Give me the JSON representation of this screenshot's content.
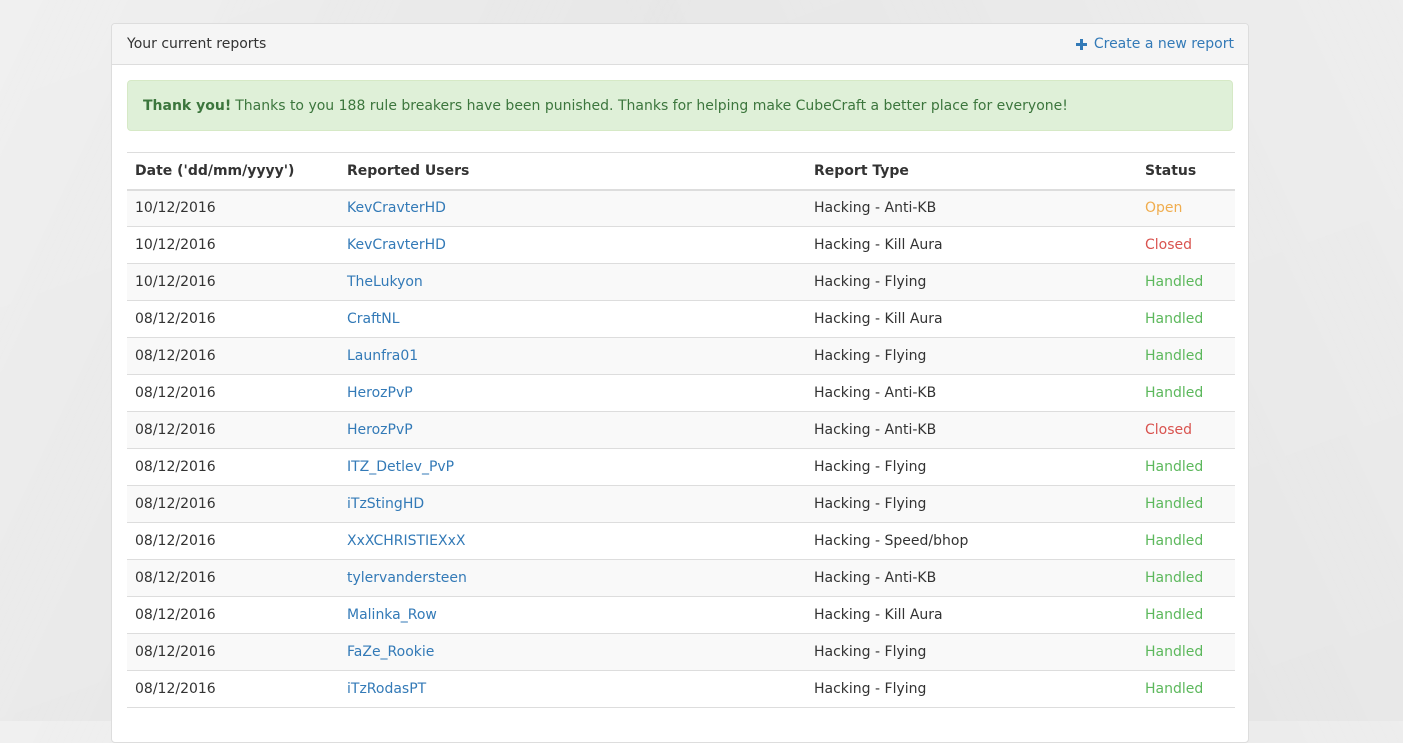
{
  "panel": {
    "title": "Your current reports",
    "create_link": "Create a new report"
  },
  "alert": {
    "strong": "Thank you!",
    "message": "Thanks to you 188 rule breakers have been punished. Thanks for helping make CubeCraft a better place for everyone!"
  },
  "table": {
    "headers": {
      "date": "Date ('dd/mm/yyyy')",
      "users": "Reported Users",
      "type": "Report Type",
      "status": "Status"
    },
    "rows": [
      {
        "date": "10/12/2016",
        "user": "KevCravterHD",
        "type": "Hacking - Anti-KB",
        "status": "Open",
        "status_class": "open"
      },
      {
        "date": "10/12/2016",
        "user": "KevCravterHD",
        "type": "Hacking - Kill Aura",
        "status": "Closed",
        "status_class": "closed"
      },
      {
        "date": "10/12/2016",
        "user": "TheLukyon",
        "type": "Hacking - Flying",
        "status": "Handled",
        "status_class": "handled"
      },
      {
        "date": "08/12/2016",
        "user": "CraftNL",
        "type": "Hacking - Kill Aura",
        "status": "Handled",
        "status_class": "handled"
      },
      {
        "date": "08/12/2016",
        "user": "Launfra01",
        "type": "Hacking - Flying",
        "status": "Handled",
        "status_class": "handled"
      },
      {
        "date": "08/12/2016",
        "user": "HerozPvP",
        "type": "Hacking - Anti-KB",
        "status": "Handled",
        "status_class": "handled"
      },
      {
        "date": "08/12/2016",
        "user": "HerozPvP",
        "type": "Hacking - Anti-KB",
        "status": "Closed",
        "status_class": "closed"
      },
      {
        "date": "08/12/2016",
        "user": "ITZ_Detlev_PvP",
        "type": "Hacking - Flying",
        "status": "Handled",
        "status_class": "handled"
      },
      {
        "date": "08/12/2016",
        "user": "iTzStingHD",
        "type": "Hacking - Flying",
        "status": "Handled",
        "status_class": "handled"
      },
      {
        "date": "08/12/2016",
        "user": "XxXCHRISTIEXxX",
        "type": "Hacking - Speed/bhop",
        "status": "Handled",
        "status_class": "handled"
      },
      {
        "date": "08/12/2016",
        "user": "tylervandersteen",
        "type": "Hacking - Anti-KB",
        "status": "Handled",
        "status_class": "handled"
      },
      {
        "date": "08/12/2016",
        "user": "Malinka_Row",
        "type": "Hacking - Kill Aura",
        "status": "Handled",
        "status_class": "handled"
      },
      {
        "date": "08/12/2016",
        "user": "FaZe_Rookie",
        "type": "Hacking - Flying",
        "status": "Handled",
        "status_class": "handled"
      },
      {
        "date": "08/12/2016",
        "user": "iTzRodasPT",
        "type": "Hacking - Flying",
        "status": "Handled",
        "status_class": "handled"
      }
    ]
  },
  "colors": {
    "link": "#337ab7",
    "open": "#f0ad4e",
    "closed": "#d9534f",
    "handled": "#5cb85c",
    "alert_bg": "#dff0d8",
    "alert_text": "#3c763d"
  }
}
